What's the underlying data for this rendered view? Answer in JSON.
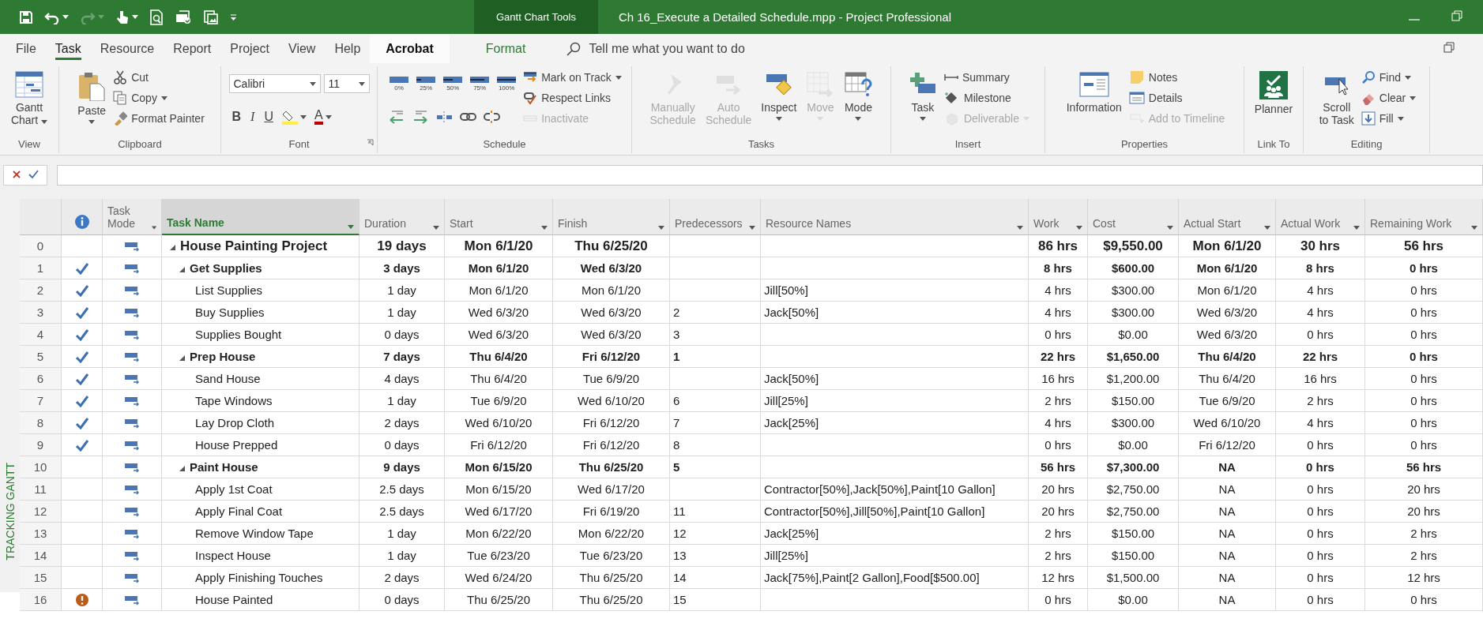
{
  "title_bar": {
    "context_tab": "Gantt Chart Tools",
    "title": "Ch 16_Execute a Detailed Schedule.mpp  -  Project Professional"
  },
  "tabs": [
    {
      "label": "File",
      "kind": "normal",
      "selected": false,
      "highlighted": false
    },
    {
      "label": "Task",
      "kind": "normal",
      "selected": true,
      "highlighted": false
    },
    {
      "label": "Resource",
      "kind": "normal",
      "selected": false,
      "highlighted": false
    },
    {
      "label": "Report",
      "kind": "normal",
      "selected": false,
      "highlighted": false
    },
    {
      "label": "Project",
      "kind": "normal",
      "selected": false,
      "highlighted": false
    },
    {
      "label": "View",
      "kind": "normal",
      "selected": false,
      "highlighted": false
    },
    {
      "label": "Help",
      "kind": "normal",
      "selected": false,
      "highlighted": false
    },
    {
      "label": "Acrobat",
      "kind": "normal",
      "selected": false,
      "highlighted": true
    },
    {
      "label": "Format",
      "kind": "contextual",
      "selected": false,
      "highlighted": false
    }
  ],
  "search": {
    "placeholder": "Tell me what you want to do"
  },
  "ribbon": {
    "groups": [
      {
        "label": "View",
        "launcher": false,
        "columns": [
          {
            "items": [
              {
                "kind": "large",
                "label_lines": [
                  "Gantt",
                  "Chart"
                ],
                "dropdown": true,
                "disabled": false
              }
            ]
          }
        ]
      },
      {
        "label": "Clipboard",
        "launcher": false,
        "columns": [
          {
            "items": [
              {
                "kind": "large",
                "label_lines": [
                  "Paste"
                ],
                "dropdown": true,
                "disabled": false
              }
            ]
          },
          {
            "items": [
              {
                "kind": "small",
                "label": "Cut",
                "dropdown": false,
                "disabled": false
              },
              {
                "kind": "small",
                "label": "Copy",
                "dropdown": true,
                "disabled": false
              },
              {
                "kind": "small",
                "label": "Format Painter",
                "dropdown": false,
                "disabled": false
              }
            ]
          }
        ]
      },
      {
        "label": "Font",
        "launcher": true,
        "columns": [
          {
            "items": [
              {
                "kind": "row",
                "items": [
                  {
                    "kind": "combo",
                    "value": "Calibri",
                    "dropdown": true,
                    "disabled": false
                  },
                  {
                    "kind": "combo",
                    "value": "11",
                    "dropdown": true,
                    "disabled": false
                  }
                ]
              },
              {
                "kind": "row",
                "items": [
                  {
                    "kind": "letter",
                    "label": "B",
                    "dropdown": false,
                    "disabled": false
                  },
                  {
                    "kind": "letter",
                    "label": "I",
                    "dropdown": false,
                    "disabled": false
                  },
                  {
                    "kind": "letter",
                    "label": "U",
                    "dropdown": false,
                    "disabled": false
                  },
                  {
                    "kind": "icon",
                    "dropdown": true,
                    "disabled": false
                  },
                  {
                    "kind": "letter",
                    "label": "A",
                    "dropdown": true,
                    "disabled": false
                  }
                ]
              }
            ]
          }
        ]
      },
      {
        "label": "Schedule",
        "launcher": false,
        "columns": [
          {
            "items": [
              {
                "kind": "row",
                "items": [
                  {
                    "kind": "pct",
                    "label": "0%",
                    "dropdown": false,
                    "disabled": false
                  },
                  {
                    "kind": "pct",
                    "label": "25%",
                    "dropdown": false,
                    "disabled": false
                  },
                  {
                    "kind": "pct",
                    "label": "50%",
                    "dropdown": false,
                    "disabled": false
                  },
                  {
                    "kind": "pct",
                    "label": "75%",
                    "dropdown": false,
                    "disabled": false
                  },
                  {
                    "kind": "pct",
                    "label": "100%",
                    "dropdown": false,
                    "disabled": false
                  }
                ]
              },
              {
                "kind": "row",
                "items": [
                  {
                    "kind": "icon",
                    "dropdown": false,
                    "disabled": false
                  },
                  {
                    "kind": "icon",
                    "dropdown": false,
                    "disabled": false
                  },
                  {
                    "kind": "icon",
                    "dropdown": false,
                    "disabled": false
                  },
                  {
                    "kind": "icon",
                    "dropdown": false,
                    "disabled": false
                  },
                  {
                    "kind": "icon",
                    "dropdown": false,
                    "disabled": false
                  }
                ]
              }
            ]
          },
          {
            "items": [
              {
                "kind": "small",
                "label": "Mark on Track",
                "dropdown": true,
                "disabled": false
              },
              {
                "kind": "small",
                "label": "Respect Links",
                "dropdown": false,
                "disabled": false
              },
              {
                "kind": "small",
                "label": "Inactivate",
                "dropdown": false,
                "disabled": true
              }
            ]
          }
        ]
      },
      {
        "label": "Tasks",
        "launcher": false,
        "columns": [
          {
            "items": [
              {
                "kind": "large",
                "label_lines": [
                  "Manually",
                  "Schedule"
                ],
                "dropdown": false,
                "disabled": true
              }
            ]
          },
          {
            "items": [
              {
                "kind": "large",
                "label_lines": [
                  "Auto",
                  "Schedule"
                ],
                "dropdown": false,
                "disabled": true
              }
            ]
          },
          {
            "items": [
              {
                "kind": "large",
                "label_lines": [
                  "Inspect"
                ],
                "dropdown": true,
                "disabled": false
              }
            ]
          },
          {
            "items": [
              {
                "kind": "large",
                "label_lines": [
                  "Move"
                ],
                "dropdown": true,
                "disabled": true
              }
            ]
          },
          {
            "items": [
              {
                "kind": "large",
                "label_lines": [
                  "Mode"
                ],
                "dropdown": true,
                "disabled": false
              }
            ]
          }
        ]
      },
      {
        "label": "Insert",
        "launcher": false,
        "columns": [
          {
            "items": [
              {
                "kind": "large",
                "label_lines": [
                  "Task"
                ],
                "dropdown": true,
                "disabled": false
              }
            ]
          },
          {
            "items": [
              {
                "kind": "small",
                "label": "Summary",
                "dropdown": false,
                "disabled": false
              },
              {
                "kind": "small",
                "label": "Milestone",
                "dropdown": false,
                "disabled": false
              },
              {
                "kind": "small",
                "label": "Deliverable",
                "dropdown": true,
                "disabled": true
              }
            ]
          }
        ]
      },
      {
        "label": "Properties",
        "launcher": false,
        "columns": [
          {
            "items": [
              {
                "kind": "large",
                "label_lines": [
                  "Information"
                ],
                "dropdown": false,
                "disabled": false
              }
            ]
          },
          {
            "items": [
              {
                "kind": "small",
                "label": "Notes",
                "dropdown": false,
                "disabled": false
              },
              {
                "kind": "small",
                "label": "Details",
                "dropdown": false,
                "disabled": false
              },
              {
                "kind": "small",
                "label": "Add to Timeline",
                "dropdown": false,
                "disabled": true
              }
            ]
          }
        ]
      },
      {
        "label": "Link To",
        "launcher": false,
        "columns": [
          {
            "items": [
              {
                "kind": "large",
                "label_lines": [
                  "Planner"
                ],
                "dropdown": false,
                "disabled": false
              }
            ]
          }
        ]
      },
      {
        "label": "Editing",
        "launcher": false,
        "columns": [
          {
            "items": [
              {
                "kind": "large",
                "label_lines": [
                  "Scroll",
                  "to Task"
                ],
                "dropdown": false,
                "disabled": false
              }
            ]
          },
          {
            "items": [
              {
                "kind": "small",
                "label": "Find",
                "dropdown": true,
                "disabled": false
              },
              {
                "kind": "small",
                "label": "Clear",
                "dropdown": true,
                "disabled": false
              },
              {
                "kind": "small",
                "label": "Fill",
                "dropdown": true,
                "disabled": false
              }
            ]
          }
        ]
      }
    ]
  },
  "view_bar": {
    "label": "TRACKING GANTT"
  },
  "table": {
    "columns": [
      {
        "label": "Task Mode",
        "selected": false
      },
      {
        "label": "Task Name",
        "selected": true
      },
      {
        "label": "Duration",
        "selected": false
      },
      {
        "label": "Start",
        "selected": false
      },
      {
        "label": "Finish",
        "selected": false
      },
      {
        "label": "Predecessors",
        "selected": false
      },
      {
        "label": "Resource Names",
        "selected": false
      },
      {
        "label": "Work",
        "selected": false
      },
      {
        "label": "Cost",
        "selected": false
      },
      {
        "label": "Actual Start",
        "selected": false
      },
      {
        "label": "Actual Work",
        "selected": false
      },
      {
        "label": "Remaining Work",
        "selected": false
      }
    ],
    "rows": [
      {
        "id": "0",
        "complete": false,
        "late": false,
        "name": "House Painting Project",
        "expanded": true,
        "duration": "19 days",
        "start": "Mon 6/1/20",
        "finish": "Thu 6/25/20",
        "work": "86 hrs",
        "cost": "$9,550.00",
        "actual_start": "Mon 6/1/20",
        "actual_work": "30 hrs",
        "remaining_work": "56 hrs",
        "children": [
          {
            "id": "1",
            "complete": true,
            "late": false,
            "name": "Get Supplies",
            "expanded": true,
            "duration": "3 days",
            "start": "Mon 6/1/20",
            "finish": "Wed 6/3/20",
            "work": "8 hrs",
            "cost": "$600.00",
            "actual_start": "Mon 6/1/20",
            "actual_work": "8 hrs",
            "remaining_work": "0 hrs",
            "children": [
              {
                "id": "2",
                "complete": true,
                "late": false,
                "name": "List Supplies",
                "duration": "1 day",
                "start": "Mon 6/1/20",
                "finish": "Mon 6/1/20",
                "resources": "Jill[50%]",
                "work": "4 hrs",
                "cost": "$300.00",
                "actual_start": "Mon 6/1/20",
                "actual_work": "4 hrs",
                "remaining_work": "0 hrs"
              },
              {
                "id": "3",
                "complete": true,
                "late": false,
                "name": "Buy Supplies",
                "duration": "1 day",
                "start": "Wed 6/3/20",
                "finish": "Wed 6/3/20",
                "predecessors": "2",
                "resources": "Jack[50%]",
                "work": "4 hrs",
                "cost": "$300.00",
                "actual_start": "Wed 6/3/20",
                "actual_work": "4 hrs",
                "remaining_work": "0 hrs"
              },
              {
                "id": "4",
                "complete": true,
                "late": false,
                "name": "Supplies Bought",
                "duration": "0 days",
                "start": "Wed 6/3/20",
                "finish": "Wed 6/3/20",
                "predecessors": "3",
                "work": "0 hrs",
                "cost": "$0.00",
                "actual_start": "Wed 6/3/20",
                "actual_work": "0 hrs",
                "remaining_work": "0 hrs"
              }
            ]
          },
          {
            "id": "5",
            "complete": true,
            "late": false,
            "name": "Prep House",
            "expanded": true,
            "duration": "7 days",
            "start": "Thu 6/4/20",
            "finish": "Fri 6/12/20",
            "predecessors": "1",
            "work": "22 hrs",
            "cost": "$1,650.00",
            "actual_start": "Thu 6/4/20",
            "actual_work": "22 hrs",
            "remaining_work": "0 hrs",
            "children": [
              {
                "id": "6",
                "complete": true,
                "late": false,
                "name": "Sand House",
                "duration": "4 days",
                "start": "Thu 6/4/20",
                "finish": "Tue 6/9/20",
                "resources": "Jack[50%]",
                "work": "16 hrs",
                "cost": "$1,200.00",
                "actual_start": "Thu 6/4/20",
                "actual_work": "16 hrs",
                "remaining_work": "0 hrs"
              },
              {
                "id": "7",
                "complete": true,
                "late": false,
                "name": "Tape Windows",
                "duration": "1 day",
                "start": "Tue 6/9/20",
                "finish": "Wed 6/10/20",
                "predecessors": "6",
                "resources": "Jill[25%]",
                "work": "2 hrs",
                "cost": "$150.00",
                "actual_start": "Tue 6/9/20",
                "actual_work": "2 hrs",
                "remaining_work": "0 hrs"
              },
              {
                "id": "8",
                "complete": true,
                "late": false,
                "name": "Lay Drop Cloth",
                "duration": "2 days",
                "start": "Wed 6/10/20",
                "finish": "Fri 6/12/20",
                "predecessors": "7",
                "resources": "Jack[25%]",
                "work": "4 hrs",
                "cost": "$300.00",
                "actual_start": "Wed 6/10/20",
                "actual_work": "4 hrs",
                "remaining_work": "0 hrs"
              },
              {
                "id": "9",
                "complete": true,
                "late": false,
                "name": "House Prepped",
                "duration": "0 days",
                "start": "Fri 6/12/20",
                "finish": "Fri 6/12/20",
                "predecessors": "8",
                "work": "0 hrs",
                "cost": "$0.00",
                "actual_start": "Fri 6/12/20",
                "actual_work": "0 hrs",
                "remaining_work": "0 hrs"
              }
            ]
          },
          {
            "id": "10",
            "complete": false,
            "late": false,
            "name": "Paint House",
            "expanded": true,
            "duration": "9 days",
            "start": "Mon 6/15/20",
            "finish": "Thu 6/25/20",
            "predecessors": "5",
            "work": "56 hrs",
            "cost": "$7,300.00",
            "actual_start": "NA",
            "actual_work": "0 hrs",
            "remaining_work": "56 hrs",
            "children": [
              {
                "id": "11",
                "complete": false,
                "late": false,
                "name": "Apply 1st Coat",
                "duration": "2.5 days",
                "start": "Mon 6/15/20",
                "finish": "Wed 6/17/20",
                "resources": "Contractor[50%],Jack[50%],Paint[10 Gallon]",
                "work": "20 hrs",
                "cost": "$2,750.00",
                "actual_start": "NA",
                "actual_work": "0 hrs",
                "remaining_work": "20 hrs"
              },
              {
                "id": "12",
                "complete": false,
                "late": false,
                "name": "Apply Final Coat",
                "duration": "2.5 days",
                "start": "Wed 6/17/20",
                "finish": "Fri 6/19/20",
                "predecessors": "11",
                "resources": "Contractor[50%],Jill[50%],Paint[10 Gallon]",
                "work": "20 hrs",
                "cost": "$2,750.00",
                "actual_start": "NA",
                "actual_work": "0 hrs",
                "remaining_work": "20 hrs"
              },
              {
                "id": "13",
                "complete": false,
                "late": false,
                "name": "Remove Window Tape",
                "duration": "1 day",
                "start": "Mon 6/22/20",
                "finish": "Mon 6/22/20",
                "predecessors": "12",
                "resources": "Jack[25%]",
                "work": "2 hrs",
                "cost": "$150.00",
                "actual_start": "NA",
                "actual_work": "0 hrs",
                "remaining_work": "2 hrs"
              },
              {
                "id": "14",
                "complete": false,
                "late": false,
                "name": "Inspect House",
                "duration": "1 day",
                "start": "Tue 6/23/20",
                "finish": "Tue 6/23/20",
                "predecessors": "13",
                "resources": "Jill[25%]",
                "work": "2 hrs",
                "cost": "$150.00",
                "actual_start": "NA",
                "actual_work": "0 hrs",
                "remaining_work": "2 hrs"
              },
              {
                "id": "15",
                "complete": false,
                "late": false,
                "name": "Apply Finishing Touches",
                "duration": "2 days",
                "start": "Wed 6/24/20",
                "finish": "Thu 6/25/20",
                "predecessors": "14",
                "resources": "Jack[75%],Paint[2 Gallon],Food[$500.00]",
                "work": "12 hrs",
                "cost": "$1,500.00",
                "actual_start": "NA",
                "actual_work": "0 hrs",
                "remaining_work": "12 hrs"
              },
              {
                "id": "16",
                "complete": false,
                "late": true,
                "name": "House Painted",
                "duration": "0 days",
                "start": "Thu 6/25/20",
                "finish": "Thu 6/25/20",
                "predecessors": "15",
                "work": "0 hrs",
                "cost": "$0.00",
                "actual_start": "NA",
                "actual_work": "0 hrs",
                "remaining_work": "0 hrs"
              }
            ]
          }
        ]
      }
    ]
  }
}
